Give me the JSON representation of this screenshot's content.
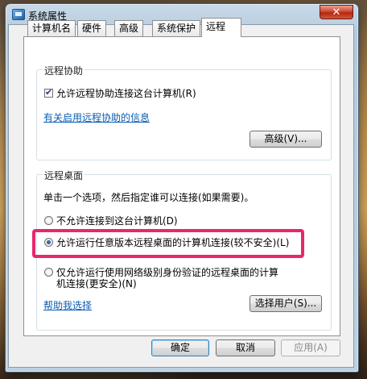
{
  "window": {
    "title": "系统属性",
    "close_label": "✕"
  },
  "tabs": [
    {
      "label": "计算机名"
    },
    {
      "label": "硬件"
    },
    {
      "label": "高级"
    },
    {
      "label": "系统保护"
    },
    {
      "label": "远程"
    }
  ],
  "remote_assistance": {
    "group_title": "远程协助",
    "allow_checkbox_label": "允许远程协助连接这台计算机(R)",
    "allow_checked": true,
    "info_link": "有关启用远程协助的信息",
    "advanced_button": "高级(V)..."
  },
  "remote_desktop": {
    "group_title": "远程桌面",
    "instruction": "单击一个选项，然后指定谁可以连接(如果需要)。",
    "options": [
      {
        "label": "不允许连接到这台计算机(D)",
        "selected": false
      },
      {
        "label": "允许运行任意版本远程桌面的计算机连接(较不安全)(L)",
        "selected": true
      },
      {
        "label_line1": "仅允许运行使用网络级别身份验证的远程桌面的计算",
        "label_line2": "机连接(更安全)(N)",
        "selected": false
      }
    ],
    "help_link": "帮助我选择",
    "select_users_button": "选择用户(S)..."
  },
  "footer": {
    "ok_button": "确定",
    "cancel_button": "取消",
    "apply_button": "应用(A)"
  },
  "colors": {
    "highlight": "#e8266e",
    "link": "#0b5cb3"
  }
}
